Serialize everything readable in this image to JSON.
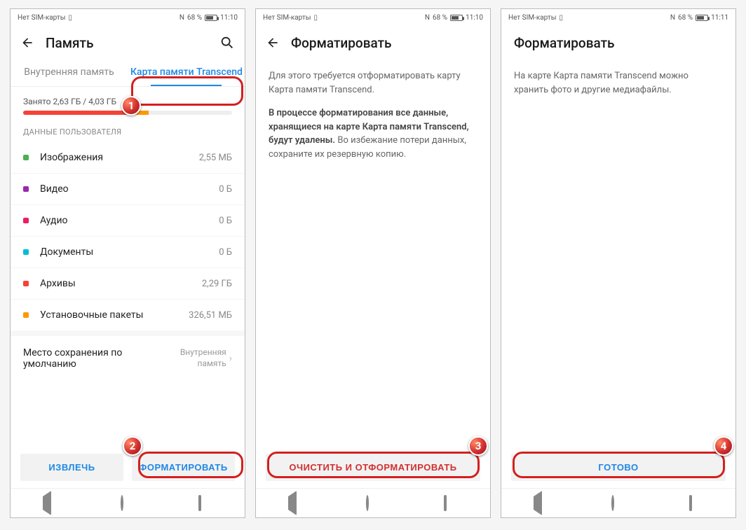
{
  "status": {
    "no_sim": "Нет SIM-карты",
    "nfc": "N",
    "battery_pct": "68 %",
    "time_a": "11:10",
    "time_c": "11:11"
  },
  "screen1": {
    "title": "Память",
    "tabs": {
      "internal": "Внутренняя память",
      "sd": "Карта памяти Transcend"
    },
    "usage": "Занято 2,63 ГБ / 4,03 ГБ",
    "section": "ДАННЫЕ ПОЛЬЗОВАТЕЛЯ",
    "rows": [
      {
        "label": "Изображения",
        "value": "2,55 МБ",
        "color": "#4caf50"
      },
      {
        "label": "Видео",
        "value": "0 Б",
        "color": "#9c27b0"
      },
      {
        "label": "Аудио",
        "value": "0 Б",
        "color": "#e91e63"
      },
      {
        "label": "Документы",
        "value": "0 Б",
        "color": "#00bcd4"
      },
      {
        "label": "Архивы",
        "value": "2,29 ГБ",
        "color": "#f44336"
      },
      {
        "label": "Установочные пакеты",
        "value": "326,51 МБ",
        "color": "#ff9800"
      }
    ],
    "default_loc_label": "Место сохранения по умолчанию",
    "default_loc_value": "Внутренняя память",
    "buttons": {
      "eject": "ИЗВЛЕЧЬ",
      "format": "ФОРМАТИРОВАТЬ"
    }
  },
  "screen2": {
    "title": "Форматировать",
    "p1": "Для этого требуется отформатировать карту Карта памяти Transcend.",
    "p2_bold": "В процессе форматирования все данные, хранящиеся на карте Карта памяти Transcend, будут удалены.",
    "p2_rest": " Во избежание потери данных, сохраните их резервную копию.",
    "button": "ОЧИСТИТЬ И ОТФОРМАТИРОВАТЬ"
  },
  "screen3": {
    "title": "Форматировать",
    "p1": "На карте Карта памяти Transcend можно хранить фото и другие медиафайлы.",
    "button": "ГОТОВО"
  }
}
